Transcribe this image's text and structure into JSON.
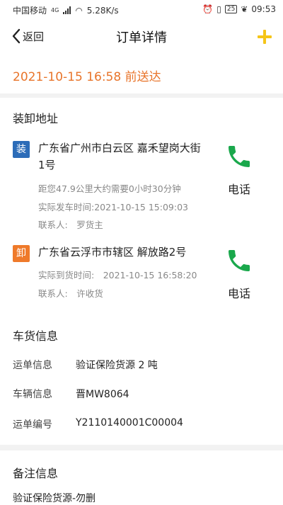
{
  "status_bar": {
    "carrier": "中国移动",
    "network": "4G",
    "speed": "5.28K/s",
    "battery": "25",
    "time": "09:53"
  },
  "nav": {
    "back_label": "返回",
    "title": "订单详情",
    "add_icon": "plus-icon",
    "accent_color": "#f5c518"
  },
  "delivery": {
    "text": "2021-10-15 16:58 前送达",
    "color": "#e8742a"
  },
  "address_section": {
    "title": "装卸地址",
    "load": {
      "tag": "装",
      "address": "广东省广州市白云区 嘉禾望岗大街1号",
      "distance": "距您47.9公里大约需要0小时30分钟",
      "depart_time": "实际发车时间:2021-10-15 15:09:03",
      "contact": "联系人:　罗货主",
      "phone_label": "电话"
    },
    "unload": {
      "tag": "卸",
      "address": "广东省云浮市市辖区 解放路2号",
      "arrive_time": "实际到货时间:　2021-10-15 16:58:20",
      "contact": "联系人:　许收货",
      "phone_label": "电话"
    }
  },
  "vehicle_section": {
    "title": "车货信息",
    "rows": [
      {
        "label": "运单信息",
        "value": "验证保险货源 2 吨"
      },
      {
        "label": "车辆信息",
        "value": "晋MW8064"
      },
      {
        "label": "运单编号",
        "value": "Y2110140001C00004"
      }
    ]
  },
  "remark_section": {
    "title": "备注信息",
    "text": "验证保险货源-勿删"
  },
  "colors": {
    "phone_green": "#1aa84c",
    "load_tag": "#2c6cb8",
    "unload_tag": "#ef7a2a"
  }
}
